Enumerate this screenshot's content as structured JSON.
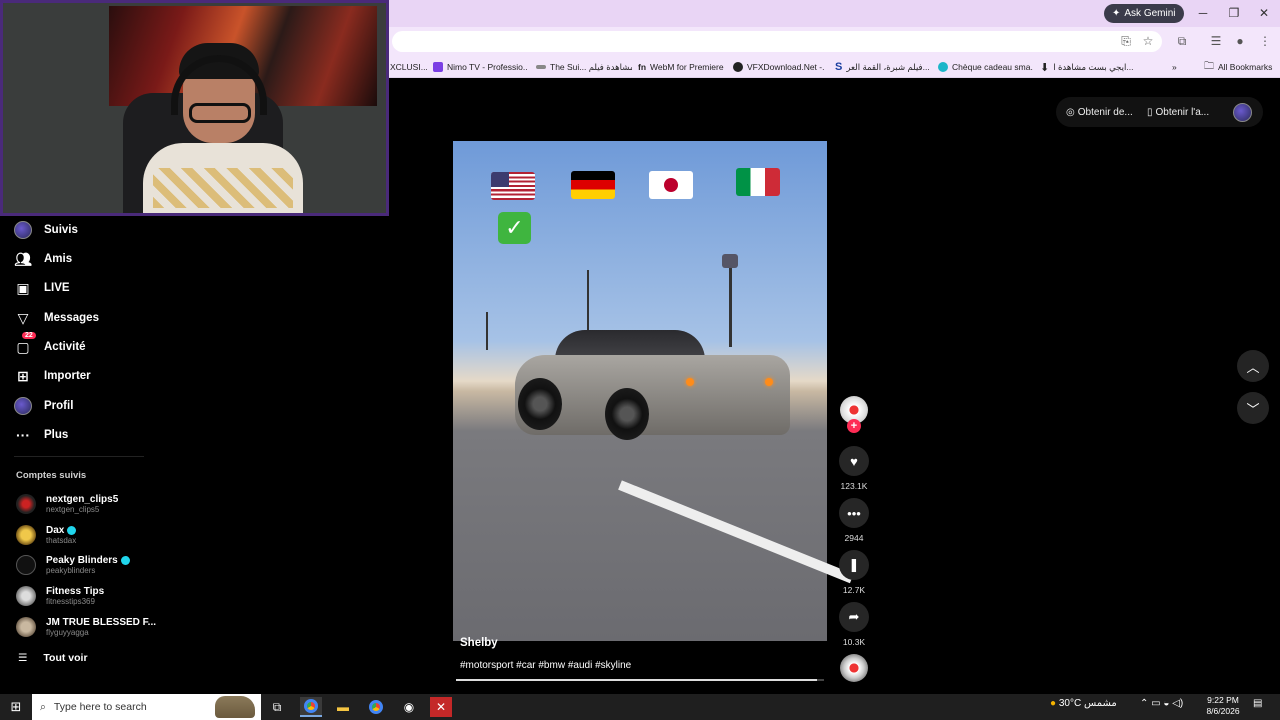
{
  "browser": {
    "ask_gemini": "Ask Gemini",
    "bookmarks": [
      {
        "label": "XCLUSI..."
      },
      {
        "label": "Nimo TV - Professio..."
      },
      {
        "label": "The Sui... مشاهدة فيلم"
      },
      {
        "label": "WebM for Premiere"
      },
      {
        "label": "VFXDownload.Net -..."
      },
      {
        "label": "فيلم شبرة، القمة العر..."
      },
      {
        "label": "Chèque cadeau sma..."
      },
      {
        "label": "ايجي بست مشاهدة ا..."
      }
    ],
    "all_bookmarks": "All Bookmarks"
  },
  "sidebar": {
    "items": [
      {
        "label": "Suivis",
        "icon": "avatar-icon"
      },
      {
        "label": "Amis",
        "icon": "friends-icon"
      },
      {
        "label": "LIVE",
        "icon": "live-icon"
      },
      {
        "label": "Messages",
        "icon": "messages-icon"
      },
      {
        "label": "Activité",
        "icon": "activity-icon",
        "badge": "22"
      },
      {
        "label": "Importer",
        "icon": "upload-icon"
      },
      {
        "label": "Profil",
        "icon": "profile-icon"
      },
      {
        "label": "Plus",
        "icon": "more-icon"
      }
    ],
    "followed_title": "Comptes suivis",
    "followed": [
      {
        "name": "nextgen_clips5",
        "handle": "nextgen_clips5",
        "verified": false
      },
      {
        "name": "Dax",
        "handle": "thatsdax",
        "verified": true
      },
      {
        "name": "Peaky Blinders",
        "handle": "peakyblinders",
        "verified": true
      },
      {
        "name": "Fitness Tips",
        "handle": "fitnesstips369",
        "verified": false
      },
      {
        "name": "JM TRUE BLESSED F...",
        "handle": "flyguyyagga",
        "verified": false
      }
    ],
    "see_all": "Tout voir"
  },
  "top_right": {
    "get_coins": "Obtenir de...",
    "get_app": "Obtenir l'a..."
  },
  "video": {
    "author": "Shelby",
    "hashtags": "#motorsport #car #bmw #audi #skyline",
    "progress": 0.98,
    "likes": "123.1K",
    "comments": "2944",
    "saves": "12.7K",
    "shares": "10.3K"
  },
  "taskbar": {
    "search_placeholder": "Type here to search",
    "weather_temp": "30°C",
    "weather_text": "مشمس",
    "time": "9:22 PM",
    "date": "8/6/2026"
  },
  "colors": {
    "accent": "#fe2c55",
    "verified": "#20d5ec",
    "chrome_bg": "#f3e6fb"
  }
}
